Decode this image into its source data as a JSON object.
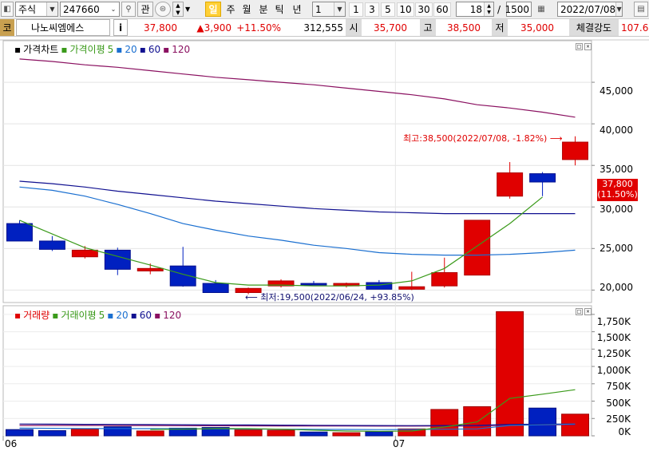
{
  "toolbar": {
    "market": "주식",
    "code": "247660",
    "button_gwan": "관",
    "periods": [
      "일",
      "주",
      "월",
      "분",
      "틱",
      "년"
    ],
    "active_period": "일",
    "interval": "1",
    "quick_intervals": [
      "1",
      "3",
      "5",
      "10",
      "30",
      "60"
    ],
    "view_count": "18",
    "total_count": "1500",
    "separator": "/",
    "date": "2022/07/08"
  },
  "quote": {
    "tag": "코",
    "name": "나노씨엠에스",
    "info_button": "i",
    "price": "37,800",
    "change": "▲3,900",
    "change_rate": "+11.50%",
    "volume": "312,555",
    "open_label": "시",
    "open": "35,700",
    "high_label": "고",
    "high": "38,500",
    "low_label": "저",
    "low": "35,000",
    "strength_label": "체결강도",
    "strength": "107.6"
  },
  "price_panel": {
    "legend": {
      "title": "가격차트",
      "ma_label": "가격이평",
      "ma_periods": [
        "5",
        "20",
        "60",
        "120"
      ],
      "ma_colors": [
        "#3a9a1a",
        "#1a6fd0",
        "#101090",
        "#8a1060"
      ]
    },
    "y_ticks": [
      "45,000",
      "40,000",
      "35,000",
      "30,000",
      "25,000",
      "20,000"
    ],
    "current_price": "37,800",
    "current_rate": "(11.50%)",
    "high_annotation": "최고:38,500(2022/07/08, -1.82%)",
    "low_annotation": "최저:19,500(2022/06/24, +93.85%)"
  },
  "volume_panel": {
    "legend": {
      "title": "거래량",
      "ma_label": "거래이평",
      "ma_periods": [
        "5",
        "20",
        "60",
        "120"
      ],
      "ma_colors": [
        "#3a9a1a",
        "#1a6fd0",
        "#101090",
        "#8a1060"
      ]
    },
    "y_ticks": [
      "1,750K",
      "1,500K",
      "1,250K",
      "1,000K",
      "750K",
      "500K",
      "250K",
      "0K"
    ]
  },
  "x_labels": [
    "06",
    "07"
  ],
  "chart_data": {
    "type": "candlestick",
    "candles": [
      {
        "o": 28000,
        "h": 28400,
        "l": 25900,
        "c": 25900,
        "v": 90000
      },
      {
        "o": 25900,
        "h": 26500,
        "l": 24700,
        "c": 24900,
        "v": 75000
      },
      {
        "o": 24000,
        "h": 25300,
        "l": 23800,
        "c": 24800,
        "v": 95000
      },
      {
        "o": 24800,
        "h": 25100,
        "l": 21800,
        "c": 22500,
        "v": 130000
      },
      {
        "o": 22300,
        "h": 23200,
        "l": 21900,
        "c": 22600,
        "v": 70000
      },
      {
        "o": 22900,
        "h": 25200,
        "l": 20400,
        "c": 20500,
        "v": 110000
      },
      {
        "o": 20800,
        "h": 21200,
        "l": 19700,
        "c": 19700,
        "v": 120000
      },
      {
        "o": 19700,
        "h": 20300,
        "l": 19500,
        "c": 20200,
        "v": 85000
      },
      {
        "o": 20500,
        "h": 21300,
        "l": 20300,
        "c": 21100,
        "v": 80000
      },
      {
        "o": 20800,
        "h": 21100,
        "l": 20600,
        "c": 20700,
        "v": 55000
      },
      {
        "o": 20500,
        "h": 20900,
        "l": 20300,
        "c": 20800,
        "v": 45000
      },
      {
        "o": 20900,
        "h": 21200,
        "l": 20100,
        "c": 20100,
        "v": 60000
      },
      {
        "o": 20100,
        "h": 22200,
        "l": 20000,
        "c": 20400,
        "v": 100000
      },
      {
        "o": 20500,
        "h": 23900,
        "l": 20300,
        "c": 22100,
        "v": 380000
      },
      {
        "o": 21800,
        "h": 28400,
        "l": 21800,
        "c": 28400,
        "v": 420000
      },
      {
        "o": 31300,
        "h": 35400,
        "l": 31000,
        "c": 34100,
        "v": 1790000
      },
      {
        "o": 34000,
        "h": 34200,
        "l": 31300,
        "c": 33000,
        "v": 400000
      },
      {
        "o": 35700,
        "h": 38500,
        "l": 35000,
        "c": 37800,
        "v": 312555
      }
    ],
    "ma5": [
      28400,
      null,
      25100,
      null,
      23000,
      21900,
      20900,
      20600,
      20600,
      20500,
      20500,
      20600,
      21100,
      22600,
      25300,
      28000,
      31200
    ],
    "ma20": [
      32400,
      32000,
      31300,
      30300,
      29200,
      28000,
      27200,
      26500,
      26000,
      25400,
      25000,
      24500,
      24300,
      24200,
      24200,
      24300,
      24500,
      24800
    ],
    "ma60": [
      33100,
      32800,
      32400,
      31900,
      31500,
      31100,
      30700,
      30400,
      30100,
      29800,
      29600,
      29400,
      29300,
      29200,
      29200,
      29200,
      29200,
      29200
    ],
    "ma120": [
      47800,
      47500,
      47100,
      46800,
      46400,
      46000,
      45600,
      45300,
      45000,
      44700,
      44300,
      43900,
      43500,
      43000,
      42300,
      41900,
      41400,
      40800
    ],
    "vol_ma5": [
      null,
      null,
      null,
      null,
      92000,
      96000,
      105000,
      103000,
      95000,
      82000,
      69000,
      65000,
      69000,
      128000,
      200000,
      540000,
      600000,
      665000
    ],
    "vol_ma20": [
      110000,
      108000,
      106000,
      105000,
      104000,
      102000,
      100000,
      98000,
      96000,
      94000,
      92000,
      90000,
      91000,
      95000,
      100000,
      150000,
      160000,
      170000
    ],
    "vol_ma60": [
      170000,
      168000,
      166000,
      164000,
      162000,
      160000,
      158000,
      156000,
      154000,
      152000,
      150000,
      148000,
      147000,
      148000,
      150000,
      165000,
      168000,
      170000
    ],
    "vol_ma120": [
      150000,
      150000,
      149000,
      148000,
      147000,
      146000,
      145000,
      144000,
      143000,
      142000,
      141000,
      140000,
      140000,
      141000,
      143000,
      155000,
      158000,
      160000
    ],
    "price_ylim": [
      18500,
      50000
    ],
    "volume_ylim": [
      0,
      1875000
    ]
  }
}
